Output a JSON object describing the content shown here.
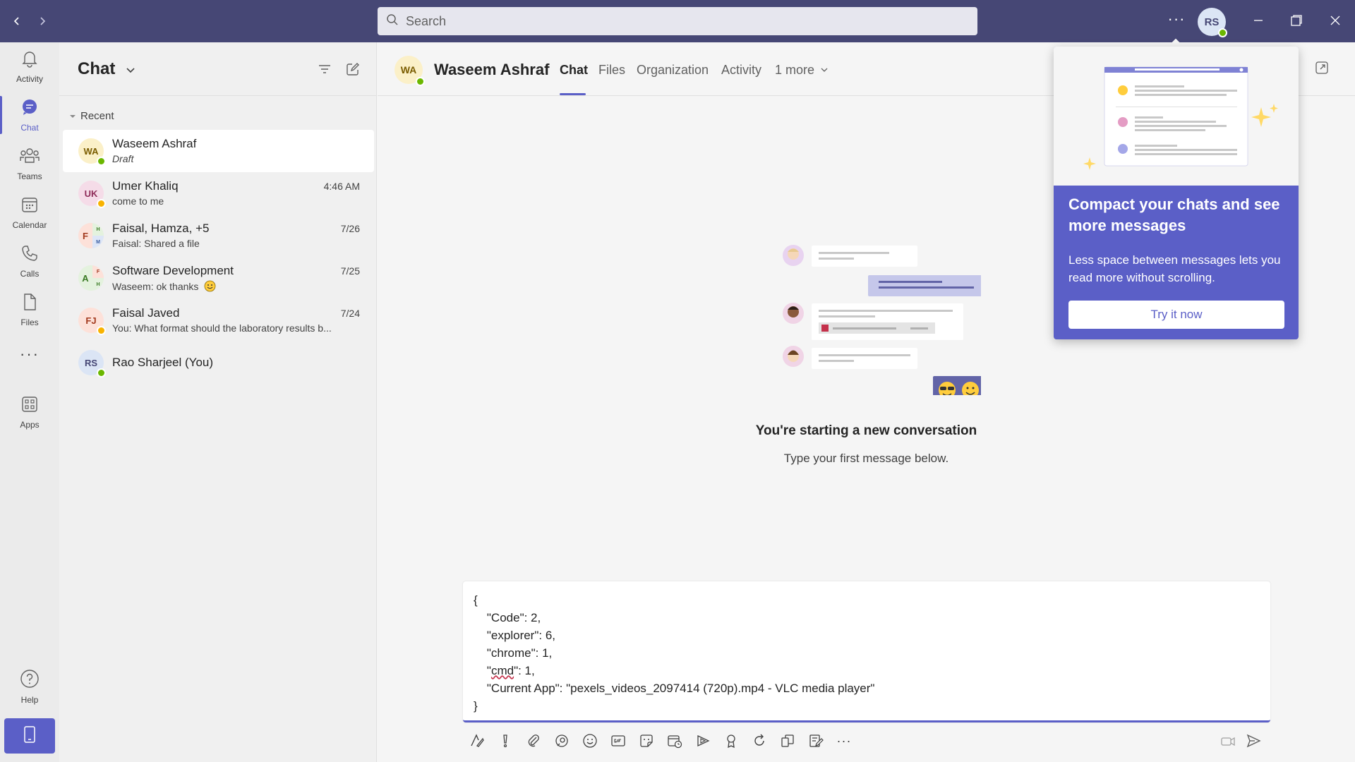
{
  "titlebar": {
    "search_placeholder": "Search",
    "user_initials": "RS"
  },
  "rail": {
    "items": [
      {
        "label": "Activity",
        "icon": "bell-icon"
      },
      {
        "label": "Chat",
        "icon": "chat-icon"
      },
      {
        "label": "Teams",
        "icon": "teams-icon"
      },
      {
        "label": "Calendar",
        "icon": "calendar-icon"
      },
      {
        "label": "Calls",
        "icon": "phone-icon"
      },
      {
        "label": "Files",
        "icon": "file-icon"
      },
      {
        "label": "Apps",
        "icon": "apps-icon"
      },
      {
        "label": "Help",
        "icon": "help-icon"
      }
    ],
    "more": "···"
  },
  "chatlist": {
    "title": "Chat",
    "section": "Recent",
    "chats": [
      {
        "initials": "WA",
        "name": "Waseem Ashraf",
        "preview": "Draft",
        "time": ""
      },
      {
        "initials": "UK",
        "name": "Umer Khaliq",
        "preview": "come to me",
        "time": "4:46 AM"
      },
      {
        "initials": "F",
        "name": "Faisal, Hamza, +5",
        "preview": "Faisal: Shared a file",
        "time": "7/26",
        "sub1": "H",
        "sub2": "M"
      },
      {
        "initials": "A",
        "name": "Software Development",
        "preview": "Waseem: ok thanks",
        "time": "7/25",
        "sub1": "F",
        "sub2": "H"
      },
      {
        "initials": "FJ",
        "name": "Faisal Javed",
        "preview": "You: What format should the laboratory results b...",
        "time": "7/24"
      },
      {
        "initials": "RS",
        "name": "Rao Sharjeel (You)",
        "preview": "",
        "time": ""
      }
    ]
  },
  "main": {
    "contact_initials": "WA",
    "contact_name": "Waseem Ashraf",
    "tabs": [
      "Chat",
      "Files",
      "Organization",
      "Activity",
      "1 more"
    ],
    "empty_title": "You're starting a new conversation",
    "empty_subtitle": "Type your first message below."
  },
  "compose": {
    "lines": [
      "{",
      "    \"Code\": 2,",
      "    \"explorer\": 6,",
      "    \"chrome\": 1,",
      "    \"",
      "    \"Current App\": \"pexels_videos_2097414 (720p).mp4 - VLC media player\"",
      "}"
    ],
    "misspelled": "cmd",
    "line5_rest": "\": 1,"
  },
  "popup": {
    "title": "Compact your chats and see more messages",
    "body": "Less space between messages lets you read more without scrolling.",
    "button": "Try it now"
  },
  "colors": {
    "titlebar": "#464775",
    "accent": "#5b5fc7",
    "available": "#6bb700",
    "away": "#f8b300"
  }
}
